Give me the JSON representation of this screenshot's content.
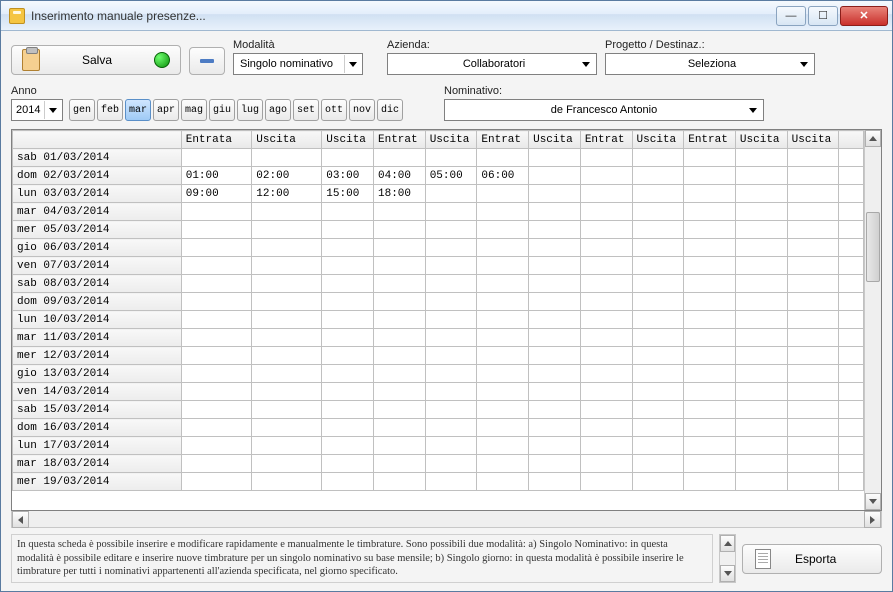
{
  "window": {
    "title": "Inserimento manuale presenze..."
  },
  "toolbar": {
    "save_label": "Salva",
    "export_label": "Esporta"
  },
  "labels": {
    "modalita": "Modalità",
    "azienda": "Azienda:",
    "progetto": "Progetto / Destinaz.:",
    "anno": "Anno",
    "nominativo": "Nominativo:"
  },
  "selects": {
    "modalita_value": "Singolo nominativo",
    "azienda_value": "Collaboratori",
    "progetto_value": "Seleziona",
    "anno_value": "2014",
    "nominativo_value": "de Francesco Antonio"
  },
  "months": {
    "items": [
      "gen",
      "feb",
      "mar",
      "apr",
      "mag",
      "giu",
      "lug",
      "ago",
      "set",
      "ott",
      "nov",
      "dic"
    ],
    "active_index": 2
  },
  "grid": {
    "headers": [
      "",
      "Entrata",
      "Uscita",
      "Entrata",
      "Uscita",
      "Entrata",
      "Uscita",
      "Entrata",
      "Uscita",
      "Entrata",
      "Uscita",
      "Entrata",
      "Uscita",
      ""
    ],
    "header_short": {
      "2": "Entrat",
      "3": "Uscita",
      "4": "Entrat",
      "5": "Uscita",
      "6": "Entrat",
      "7": "Uscita",
      "8": "Entrat",
      "9": "Uscita",
      "10": "Entrat",
      "11": "Uscita"
    },
    "rows": [
      {
        "date": "sab 01/03/2014",
        "cells": [
          "",
          "",
          "",
          "",
          "",
          "",
          "",
          "",
          "",
          "",
          "",
          ""
        ]
      },
      {
        "date": "dom 02/03/2014",
        "cells": [
          "01:00",
          "02:00",
          "03:00",
          "04:00",
          "05:00",
          "06:00",
          "",
          "",
          "",
          "",
          "",
          ""
        ]
      },
      {
        "date": "lun 03/03/2014",
        "cells": [
          "09:00",
          "12:00",
          "15:00",
          "18:00",
          "",
          "",
          "",
          "",
          "",
          "",
          "",
          ""
        ]
      },
      {
        "date": "mar 04/03/2014",
        "cells": [
          "",
          "",
          "",
          "",
          "",
          "",
          "",
          "",
          "",
          "",
          "",
          ""
        ]
      },
      {
        "date": "mer 05/03/2014",
        "cells": [
          "",
          "",
          "",
          "",
          "",
          "",
          "",
          "",
          "",
          "",
          "",
          ""
        ]
      },
      {
        "date": "gio 06/03/2014",
        "cells": [
          "",
          "",
          "",
          "",
          "",
          "",
          "",
          "",
          "",
          "",
          "",
          ""
        ]
      },
      {
        "date": "ven 07/03/2014",
        "cells": [
          "",
          "",
          "",
          "",
          "",
          "",
          "",
          "",
          "",
          "",
          "",
          ""
        ]
      },
      {
        "date": "sab 08/03/2014",
        "cells": [
          "",
          "",
          "",
          "",
          "",
          "",
          "",
          "",
          "",
          "",
          "",
          ""
        ]
      },
      {
        "date": "dom 09/03/2014",
        "cells": [
          "",
          "",
          "",
          "",
          "",
          "",
          "",
          "",
          "",
          "",
          "",
          ""
        ]
      },
      {
        "date": "lun 10/03/2014",
        "cells": [
          "",
          "",
          "",
          "",
          "",
          "",
          "",
          "",
          "",
          "",
          "",
          ""
        ]
      },
      {
        "date": "mar 11/03/2014",
        "cells": [
          "",
          "",
          "",
          "",
          "",
          "",
          "",
          "",
          "",
          "",
          "",
          ""
        ]
      },
      {
        "date": "mer 12/03/2014",
        "cells": [
          "",
          "",
          "",
          "",
          "",
          "",
          "",
          "",
          "",
          "",
          "",
          ""
        ]
      },
      {
        "date": "gio 13/03/2014",
        "cells": [
          "",
          "",
          "",
          "",
          "",
          "",
          "",
          "",
          "",
          "",
          "",
          ""
        ]
      },
      {
        "date": "ven 14/03/2014",
        "cells": [
          "",
          "",
          "",
          "",
          "",
          "",
          "",
          "",
          "",
          "",
          "",
          ""
        ]
      },
      {
        "date": "sab 15/03/2014",
        "cells": [
          "",
          "",
          "",
          "",
          "",
          "",
          "",
          "",
          "",
          "",
          "",
          ""
        ]
      },
      {
        "date": "dom 16/03/2014",
        "cells": [
          "",
          "",
          "",
          "",
          "",
          "",
          "",
          "",
          "",
          "",
          "",
          ""
        ]
      },
      {
        "date": "lun 17/03/2014",
        "cells": [
          "",
          "",
          "",
          "",
          "",
          "",
          "",
          "",
          "",
          "",
          "",
          ""
        ]
      },
      {
        "date": "mar 18/03/2014",
        "cells": [
          "",
          "",
          "",
          "",
          "",
          "",
          "",
          "",
          "",
          "",
          "",
          ""
        ]
      },
      {
        "date": "mer 19/03/2014",
        "cells": [
          "",
          "",
          "",
          "",
          "",
          "",
          "",
          "",
          "",
          "",
          "",
          ""
        ]
      }
    ]
  },
  "help_text": "In questa scheda è possibile inserire e modificare rapidamente e manualmente le timbrature. Sono possibili due modalità: a) Singolo Nominativo: in questa modalità è possibile editare e inserire nuove timbrature per un singolo nominativo su base mensile; b) Singolo giorno: in questa modalità è possibile inserire le timbrature per tutti i nominativi appartenenti all'azienda specificata, nel giorno specificato."
}
